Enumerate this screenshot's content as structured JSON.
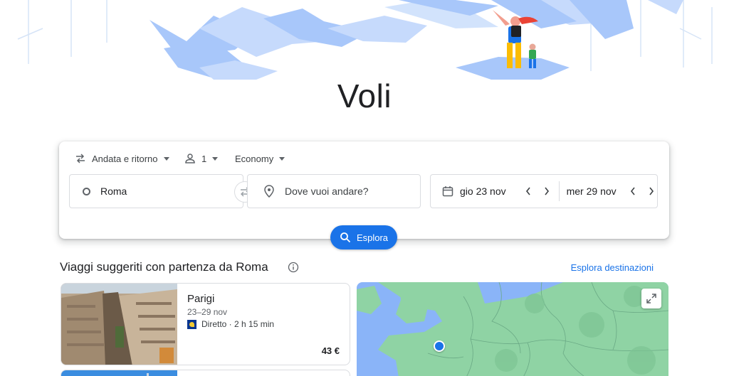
{
  "page_title": "Voli",
  "search": {
    "trip_type": "Andata e ritorno",
    "passengers": "1",
    "cabin_class": "Economy",
    "origin": "Roma",
    "destination_placeholder": "Dove vuoi andare?",
    "depart_date": "gio 23 nov",
    "return_date": "mer 29 nov",
    "explore_button": "Esplora"
  },
  "suggestions": {
    "title": "Viaggi suggeriti con partenza da Roma",
    "explore_link": "Esplora destinazioni",
    "trips": [
      {
        "city": "Parigi",
        "dates": "23–29 nov",
        "info": "Diretto · 2 h 15 min",
        "price": "43 €"
      }
    ]
  },
  "colors": {
    "accent": "#1a73e8",
    "map_land": "#8fd3a4",
    "map_water": "#8ab4f8"
  },
  "icons": [
    "swap-icon",
    "person-icon",
    "origin-icon",
    "location-pin-icon",
    "calendar-icon",
    "search-icon",
    "info-icon",
    "expand-icon"
  ]
}
